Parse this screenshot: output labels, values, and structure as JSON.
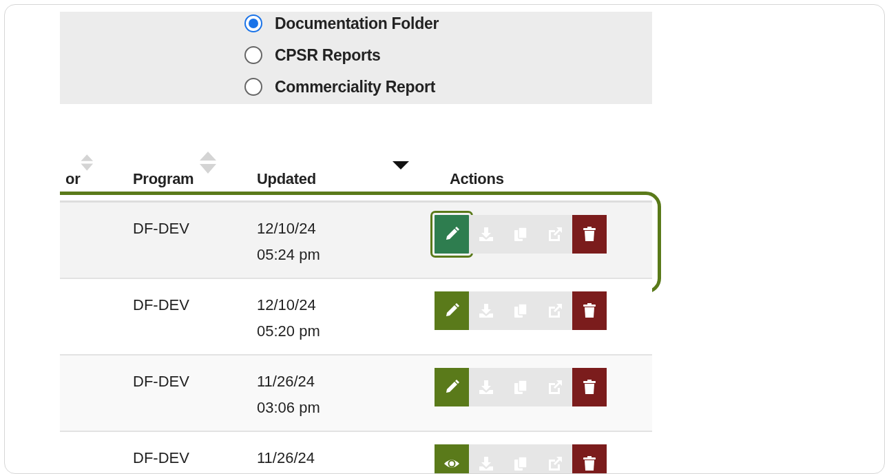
{
  "options": [
    {
      "label": "Documentation Folder",
      "selected": true
    },
    {
      "label": "CPSR Reports",
      "selected": false
    },
    {
      "label": "Commerciality Report",
      "selected": false
    }
  ],
  "table": {
    "columns": [
      {
        "label": "or",
        "sortable": true,
        "sorted": false
      },
      {
        "label": "Program",
        "sortable": true,
        "sorted": false
      },
      {
        "label": "Updated",
        "sortable": true,
        "sorted": true
      },
      {
        "label": "Actions",
        "sortable": false
      }
    ],
    "rows": [
      {
        "program": "DF-DEV",
        "updated_date": "12/10/24",
        "updated_time": "05:24 pm",
        "highlighted": true,
        "actions": [
          {
            "kind": "edit",
            "disabled": false,
            "highlighted": true
          },
          {
            "kind": "download",
            "disabled": true,
            "highlighted": false
          },
          {
            "kind": "copy",
            "disabled": true,
            "highlighted": false
          },
          {
            "kind": "link",
            "disabled": true,
            "highlighted": false
          },
          {
            "kind": "delete",
            "disabled": false,
            "highlighted": false
          }
        ]
      },
      {
        "program": "DF-DEV",
        "updated_date": "12/10/24",
        "updated_time": "05:20 pm",
        "highlighted": false,
        "actions": [
          {
            "kind": "edit",
            "disabled": false,
            "highlighted": false
          },
          {
            "kind": "download",
            "disabled": true,
            "highlighted": false
          },
          {
            "kind": "copy",
            "disabled": true,
            "highlighted": false
          },
          {
            "kind": "link",
            "disabled": true,
            "highlighted": false
          },
          {
            "kind": "delete",
            "disabled": false,
            "highlighted": false
          }
        ]
      },
      {
        "program": "DF-DEV",
        "updated_date": "11/26/24",
        "updated_time": "03:06 pm",
        "highlighted": false,
        "actions": [
          {
            "kind": "edit",
            "disabled": false,
            "highlighted": false
          },
          {
            "kind": "download",
            "disabled": true,
            "highlighted": false
          },
          {
            "kind": "copy",
            "disabled": true,
            "highlighted": false
          },
          {
            "kind": "link",
            "disabled": true,
            "highlighted": false
          },
          {
            "kind": "delete",
            "disabled": false,
            "highlighted": false
          }
        ]
      },
      {
        "program": "DF-DEV",
        "updated_date": "11/26/24",
        "highlighted": false,
        "actions": [
          {
            "kind": "view",
            "disabled": false,
            "highlighted": false
          },
          {
            "kind": "download",
            "disabled": true,
            "highlighted": false
          },
          {
            "kind": "copy",
            "disabled": true,
            "highlighted": false
          },
          {
            "kind": "link",
            "disabled": true,
            "highlighted": false
          },
          {
            "kind": "delete",
            "disabled": false,
            "highlighted": false
          }
        ]
      }
    ]
  }
}
